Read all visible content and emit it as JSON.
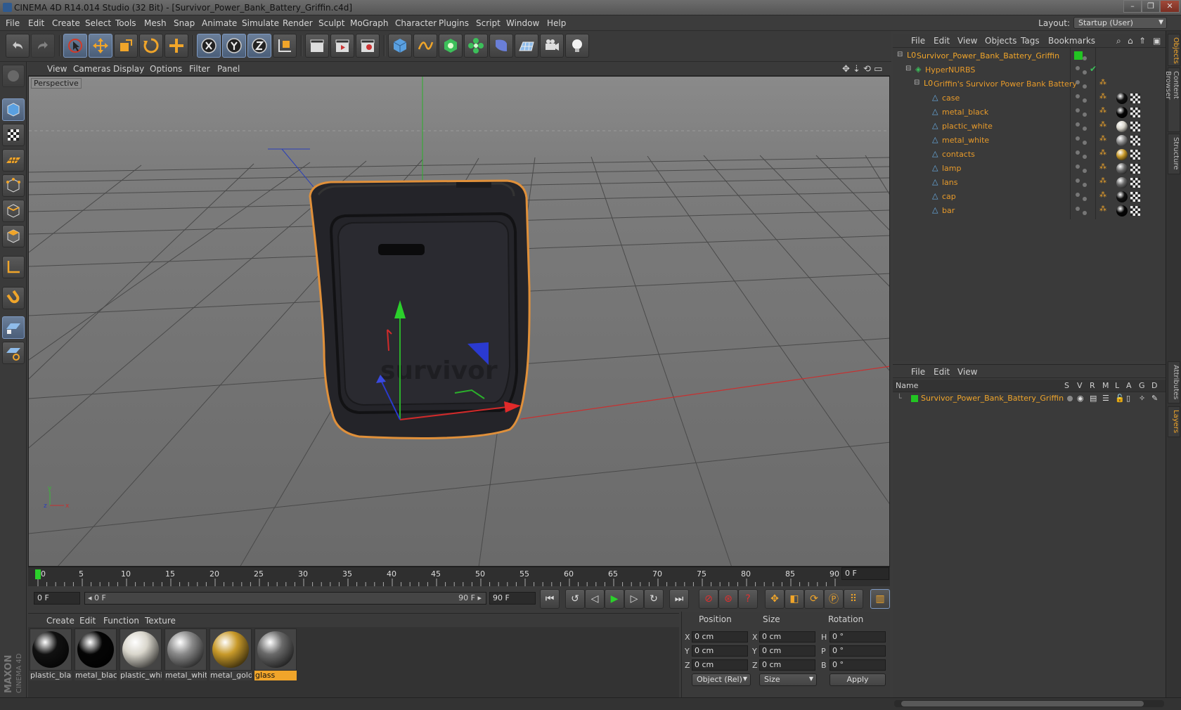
{
  "window": {
    "title": "CINEMA 4D R14.014 Studio (32 Bit) - [Survivor_Power_Bank_Battery_Griffin.c4d]",
    "controls": [
      "–",
      "❐",
      "✕"
    ]
  },
  "menubar": {
    "items": [
      "File",
      "Edit",
      "Create",
      "Select",
      "Tools",
      "Mesh",
      "Snap",
      "Animate",
      "Simulate",
      "Render",
      "Sculpt",
      "MoGraph",
      "Character",
      "Plugins",
      "Script",
      "Window",
      "Help"
    ],
    "layout_label": "Layout:",
    "layout_value": "Startup (User)"
  },
  "viewport": {
    "menu": [
      "View",
      "Cameras",
      "Display",
      "Options",
      "Filter",
      "Panel"
    ],
    "label": "Perspective",
    "model_text": "survivor"
  },
  "timeline": {
    "ticks": [
      "0",
      "5",
      "10",
      "15",
      "20",
      "25",
      "30",
      "35",
      "40",
      "45",
      "50",
      "55",
      "60",
      "65",
      "70",
      "75",
      "80",
      "85",
      "90"
    ],
    "current_frame": "0 F",
    "start_field": "0 F",
    "range_start": "◂ 0 F",
    "range_end": "90 F ▸",
    "end_field": "90 F"
  },
  "materials": {
    "menu": [
      "Create",
      "Edit",
      "Function",
      "Texture"
    ],
    "items": [
      {
        "name": "plastic_blac",
        "color": "#111111"
      },
      {
        "name": "metal_black",
        "color": "#050505"
      },
      {
        "name": "plastic_whi",
        "color": "#d9d6cc"
      },
      {
        "name": "metal_whit",
        "color": "#8a8a8a"
      },
      {
        "name": "metal_gold",
        "color": "#c89a2a"
      },
      {
        "name": "glass",
        "color": "#6a6a6a"
      }
    ],
    "brand_line1": "MAXON",
    "brand_line2": "CINEMA 4D"
  },
  "coordinates": {
    "headers": [
      "Position",
      "Size",
      "Rotation"
    ],
    "position": [
      {
        "axis": "X",
        "value": "0 cm"
      },
      {
        "axis": "Y",
        "value": "0 cm"
      },
      {
        "axis": "Z",
        "value": "0 cm"
      }
    ],
    "size": [
      {
        "axis": "X",
        "value": "0 cm"
      },
      {
        "axis": "Y",
        "value": "0 cm"
      },
      {
        "axis": "Z",
        "value": "0 cm"
      }
    ],
    "rotation": [
      {
        "axis": "H",
        "value": "0 °"
      },
      {
        "axis": "P",
        "value": "0 °"
      },
      {
        "axis": "B",
        "value": "0 °"
      }
    ],
    "mode_dropdown": "Object (Rel)",
    "size_dropdown": "Size",
    "apply_label": "Apply"
  },
  "objects_panel": {
    "menu": [
      "File",
      "Edit",
      "View",
      "Objects",
      "Tags",
      "Bookmarks"
    ],
    "tree": [
      {
        "name": "Survivor_Power_Bank_Battery_Griffin"
      },
      {
        "name": "HyperNURBS"
      },
      {
        "name": "Griffin's Survivor Power Bank Battery"
      },
      {
        "name": "case",
        "tag_color": "#111111"
      },
      {
        "name": "metal_black",
        "tag_color": "#050505"
      },
      {
        "name": "plactic_white",
        "tag_color": "#d9d6cc"
      },
      {
        "name": "metal_white",
        "tag_color": "#8a8a8a"
      },
      {
        "name": "contacts",
        "tag_color": "#c89a2a"
      },
      {
        "name": "lamp",
        "tag_color": "#6a6a6a"
      },
      {
        "name": "lans",
        "tag_color": "#6a6a6a"
      },
      {
        "name": "cap",
        "tag_color": "#111111"
      },
      {
        "name": "bar",
        "tag_color": "#050505"
      }
    ]
  },
  "layers_panel": {
    "menu": [
      "File",
      "Edit",
      "View"
    ],
    "columns": [
      "Name",
      "S",
      "V",
      "R",
      "M",
      "L",
      "A",
      "G",
      "D"
    ],
    "rows": [
      {
        "name": "Survivor_Power_Bank_Battery_Griffin",
        "color": "#22c522"
      }
    ]
  },
  "right_tabs": [
    "Objects",
    "Content Browser",
    "Structure",
    "Attributes",
    "Layers"
  ],
  "colors": {
    "accent": "#f0a52a",
    "selection": "#7d99c2"
  }
}
